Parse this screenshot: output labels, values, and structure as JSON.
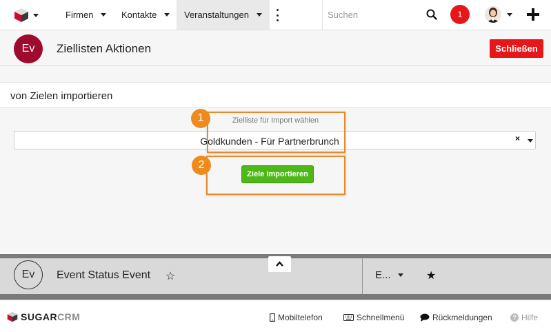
{
  "nav": {
    "items": [
      {
        "label": "Firmen"
      },
      {
        "label": "Kontakte"
      },
      {
        "label": "Veranstaltungen"
      }
    ],
    "search_placeholder": "Suchen",
    "notification_count": "1"
  },
  "header": {
    "badge": "Ev",
    "title": "Ziellisten Aktionen",
    "close_label": "Schließen"
  },
  "section": {
    "title": "von Zielen importieren"
  },
  "form": {
    "field_label": "Zielliste für Import wählen",
    "selected_value": "Goldkunden - Für Partnerbrunch",
    "clear_icon": "×",
    "import_label": "Ziele importieren"
  },
  "callouts": [
    "1",
    "2"
  ],
  "record": {
    "badge": "Ev",
    "title": "Event Status Event",
    "truncated_item": "E...",
    "star_outline": "☆",
    "star_filled": "★"
  },
  "footer": {
    "brand_sugar": "SUGAR",
    "brand_crm": "CRM",
    "links": {
      "mobile": "Mobiltelefon",
      "shortcuts": "Schnellmenü",
      "feedback": "Rückmeldungen",
      "help": "Hilfe"
    }
  },
  "colors": {
    "accent_red": "#e61718",
    "event_badge": "#9f0b2e",
    "primary_green": "#4db818",
    "callout_orange": "#ef8a1c"
  }
}
